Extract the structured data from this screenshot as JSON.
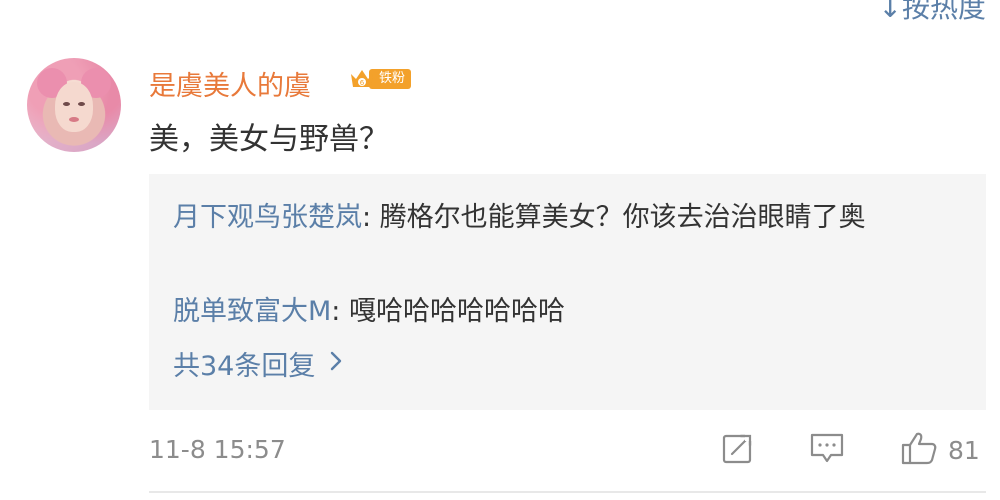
{
  "header": {
    "sort_label": "↓按热度"
  },
  "comment": {
    "username": "是虞美人的虞",
    "badge_label": "铁粉",
    "text": "美，美女与野兽？",
    "replies": [
      {
        "author": "月下观鸟张楚岚",
        "text": "腾格尔也能算美女？你该去治治眼睛了奥"
      },
      {
        "author": "脱单致富大M",
        "text": "嘎哈哈哈哈哈哈哈"
      }
    ],
    "more_replies_label": "共34条回复",
    "timestamp": "11-8 15:57",
    "like_count": "81"
  },
  "icons": {
    "avatar": "user-avatar",
    "badge": "crown-icon",
    "repost": "repost-icon",
    "comment": "comment-icon",
    "like": "thumbs-up-icon",
    "chevron": "chevron-right-icon"
  },
  "colors": {
    "username": "#e8793a",
    "link": "#5b7fa8",
    "badge": "#f3a12b",
    "reply_bg": "#f5f5f5",
    "meta": "#8c8c8c"
  }
}
